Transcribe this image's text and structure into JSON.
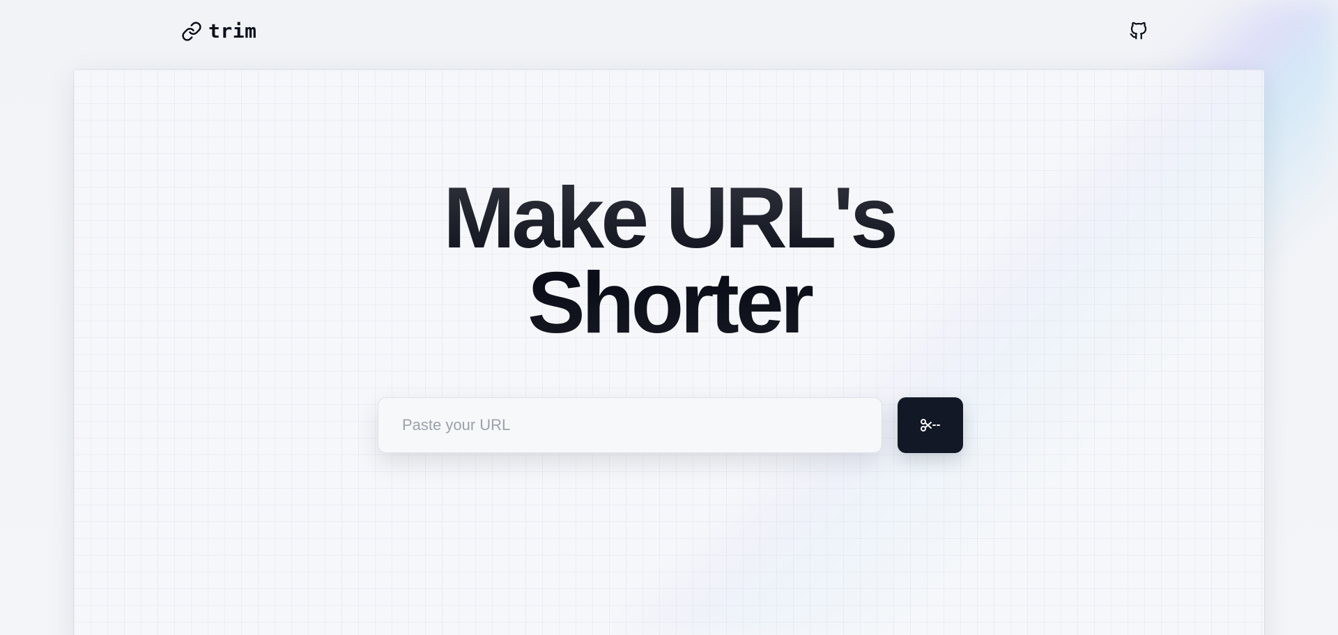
{
  "header": {
    "brand_label": "trim",
    "brand_icon": "link-icon",
    "github_icon": "github-icon"
  },
  "hero": {
    "title_line1": "Make URL's",
    "title_line2": "Shorter"
  },
  "form": {
    "url_placeholder": "Paste your URL",
    "url_value": "",
    "submit_icon": "scissors-icon"
  },
  "colors": {
    "background": "#eff2f6",
    "title": "#0b0f1a",
    "button": "#121826",
    "placeholder": "#9aa1ab"
  }
}
